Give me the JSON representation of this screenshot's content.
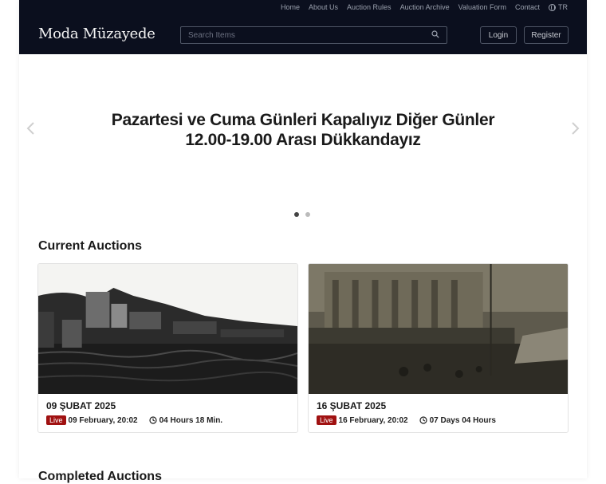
{
  "nav": {
    "links": [
      "Home",
      "About Us",
      "Auction Rules",
      "Auction Archive",
      "Valuation Form",
      "Contact"
    ],
    "language": "TR"
  },
  "header": {
    "logo": "Moda Müzayede",
    "search_placeholder": "Search Items",
    "login": "Login",
    "register": "Register"
  },
  "hero": {
    "text": "Pazartesi ve Cuma Günleri Kapalıyız Diğer Günler 12.00-19.00 Arası Dükkandayız",
    "slides": 2,
    "active_slide": 0
  },
  "current": {
    "title": "Current Auctions",
    "auctions": [
      {
        "title": "09 ŞUBAT 2025",
        "badge": "Live",
        "date": "09 February, 20:02",
        "remaining": "04 Hours 18 Min."
      },
      {
        "title": "16 ŞUBAT 2025",
        "badge": "Live",
        "date": "16 February, 20:02",
        "remaining": "07 Days 04 Hours"
      }
    ]
  },
  "completed": {
    "title": "Completed Auctions"
  },
  "colors": {
    "header_bg": "#0b0f1e",
    "live_badge": "#a01111"
  }
}
